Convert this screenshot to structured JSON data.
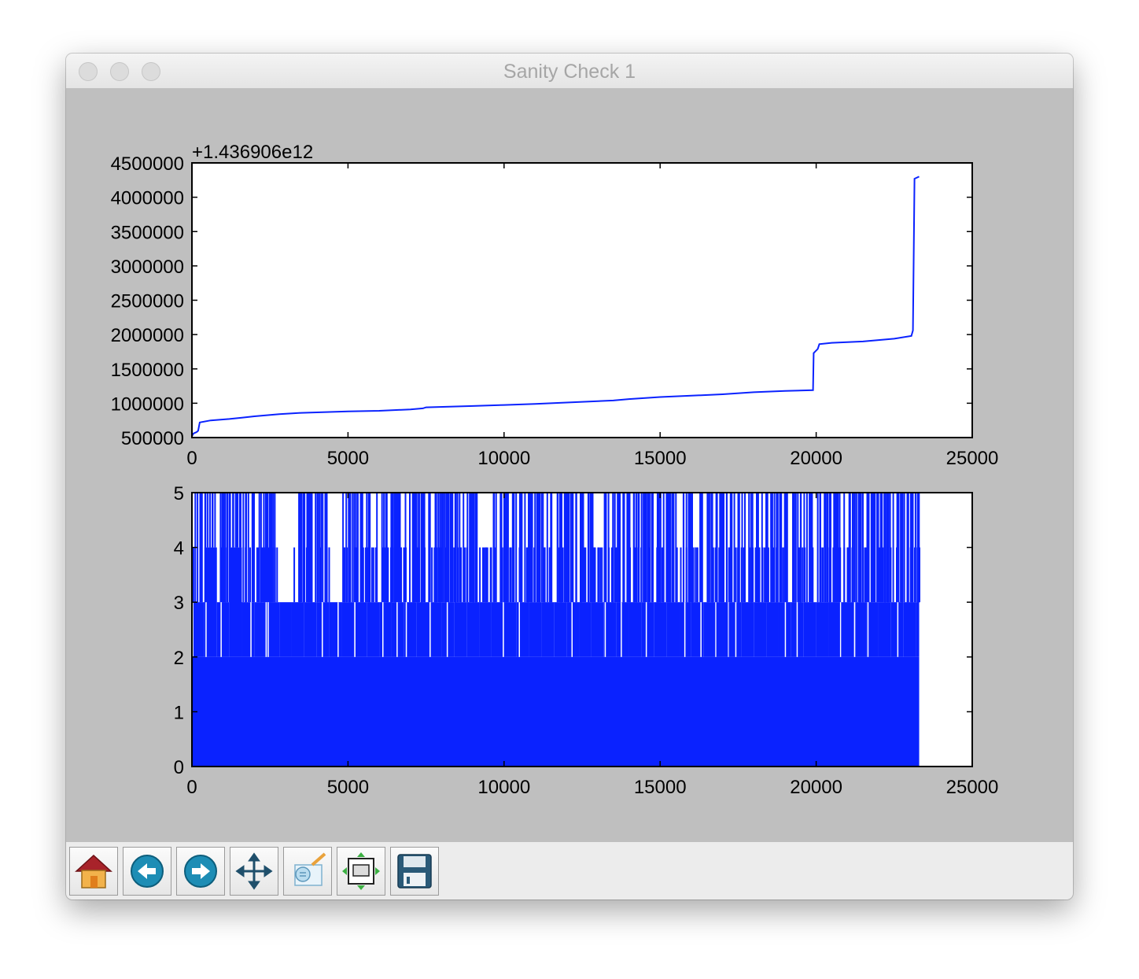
{
  "window": {
    "title": "Sanity Check 1"
  },
  "toolbar": {
    "buttons": [
      {
        "name": "home-button",
        "icon": "home-icon"
      },
      {
        "name": "back-button",
        "icon": "arrow-left-icon"
      },
      {
        "name": "forward-button",
        "icon": "arrow-right-icon"
      },
      {
        "name": "pan-button",
        "icon": "move-icon"
      },
      {
        "name": "zoom-button",
        "icon": "zoom-rect-icon"
      },
      {
        "name": "subplots-button",
        "icon": "subplots-icon"
      },
      {
        "name": "save-button",
        "icon": "floppy-disk-icon"
      }
    ]
  },
  "colors": {
    "line": "#0a22ff",
    "axes_bg": "#ffffff",
    "figure_bg": "#bfbfbf"
  },
  "chart_data": [
    {
      "type": "line",
      "offset_label": "+1.436906e12",
      "ylim": [
        500000,
        4500000
      ],
      "xlim": [
        0,
        25000
      ],
      "x_ticks": [
        "0",
        "5000",
        "10000",
        "15000",
        "20000",
        "25000"
      ],
      "y_ticks": [
        "500000",
        "1000000",
        "1500000",
        "2000000",
        "2500000",
        "3000000",
        "3500000",
        "4000000",
        "4500000"
      ],
      "grid": false,
      "series": [
        {
          "x": [
            0,
            50,
            150,
            200,
            250,
            600,
            1200,
            1600,
            2000,
            2800,
            3500,
            5000,
            6000,
            7000,
            7400,
            7500,
            9000,
            10000,
            11000,
            12000,
            13500,
            14000,
            15000,
            16000,
            17000,
            18000,
            19000,
            19900,
            19920,
            20050,
            20100,
            20500,
            21500,
            22500,
            23050,
            23100,
            23150,
            23300
          ],
          "y": [
            520000,
            560000,
            580000,
            600000,
            720000,
            750000,
            770000,
            790000,
            810000,
            840000,
            860000,
            880000,
            890000,
            910000,
            925000,
            940000,
            960000,
            975000,
            990000,
            1010000,
            1040000,
            1060000,
            1090000,
            1110000,
            1130000,
            1160000,
            1180000,
            1190000,
            1730000,
            1790000,
            1860000,
            1880000,
            1900000,
            1940000,
            1980000,
            2060000,
            4270000,
            4300000
          ]
        }
      ]
    },
    {
      "type": "bar",
      "ylim": [
        0,
        5
      ],
      "xlim": [
        0,
        25000
      ],
      "x_ticks": [
        "0",
        "5000",
        "10000",
        "15000",
        "20000",
        "25000"
      ],
      "y_ticks": [
        "0",
        "1",
        "2",
        "3",
        "4",
        "5"
      ],
      "grid": false,
      "data_extent": [
        0,
        23300
      ],
      "values_by_x": [
        {
          "x": 0,
          "top": 5,
          "base": 3
        },
        {
          "x": 400,
          "top": 5,
          "base": 4
        },
        {
          "x": 800,
          "top": 5,
          "base": 3
        },
        {
          "x": 1200,
          "top": 5,
          "base": 4
        },
        {
          "x": 1600,
          "top": 5,
          "base": 3
        },
        {
          "x": 2000,
          "top": 5,
          "base": 3
        },
        {
          "x": 2400,
          "top": 5,
          "base": 3
        },
        {
          "x": 2800,
          "top": 3,
          "base": 3
        },
        {
          "x": 3200,
          "top": 5,
          "base": 3
        },
        {
          "x": 3600,
          "top": 5,
          "base": 3
        },
        {
          "x": 4000,
          "top": 5,
          "base": 3
        },
        {
          "x": 4400,
          "top": 3,
          "base": 3
        },
        {
          "x": 4800,
          "top": 5,
          "base": 3
        },
        {
          "x": 5200,
          "top": 5,
          "base": 3
        },
        {
          "x": 5600,
          "top": 5,
          "base": 3
        },
        {
          "x": 6000,
          "top": 5,
          "base": 3
        },
        {
          "x": 6400,
          "top": 5,
          "base": 3
        },
        {
          "x": 6800,
          "top": 5,
          "base": 3
        },
        {
          "x": 7200,
          "top": 5,
          "base": 3
        },
        {
          "x": 7600,
          "top": 5,
          "base": 3
        },
        {
          "x": 8000,
          "top": 5,
          "base": 3
        },
        {
          "x": 8400,
          "top": 5,
          "base": 3
        },
        {
          "x": 8800,
          "top": 5,
          "base": 3
        },
        {
          "x": 9200,
          "top": 4,
          "base": 3
        },
        {
          "x": 9600,
          "top": 5,
          "base": 3
        },
        {
          "x": 10000,
          "top": 5,
          "base": 3
        },
        {
          "x": 10400,
          "top": 5,
          "base": 3
        },
        {
          "x": 10800,
          "top": 5,
          "base": 3
        },
        {
          "x": 11200,
          "top": 5,
          "base": 3
        },
        {
          "x": 11600,
          "top": 5,
          "base": 3
        },
        {
          "x": 12000,
          "top": 5,
          "base": 3
        },
        {
          "x": 12400,
          "top": 5,
          "base": 3
        },
        {
          "x": 12800,
          "top": 5,
          "base": 3
        },
        {
          "x": 13200,
          "top": 5,
          "base": 3
        },
        {
          "x": 13600,
          "top": 5,
          "base": 3
        },
        {
          "x": 14000,
          "top": 5,
          "base": 3
        },
        {
          "x": 14400,
          "top": 5,
          "base": 3
        },
        {
          "x": 14800,
          "top": 5,
          "base": 3
        },
        {
          "x": 15200,
          "top": 5,
          "base": 3
        },
        {
          "x": 15600,
          "top": 5,
          "base": 3
        },
        {
          "x": 16000,
          "top": 5,
          "base": 3
        },
        {
          "x": 16400,
          "top": 5,
          "base": 3
        },
        {
          "x": 16800,
          "top": 5,
          "base": 3
        },
        {
          "x": 17200,
          "top": 5,
          "base": 3
        },
        {
          "x": 17600,
          "top": 5,
          "base": 3
        },
        {
          "x": 18000,
          "top": 5,
          "base": 3
        },
        {
          "x": 18400,
          "top": 5,
          "base": 3
        },
        {
          "x": 18800,
          "top": 5,
          "base": 3
        },
        {
          "x": 19200,
          "top": 5,
          "base": 3
        },
        {
          "x": 19600,
          "top": 5,
          "base": 3
        },
        {
          "x": 20000,
          "top": 5,
          "base": 3
        },
        {
          "x": 20400,
          "top": 5,
          "base": 3
        },
        {
          "x": 20800,
          "top": 5,
          "base": 3
        },
        {
          "x": 21200,
          "top": 5,
          "base": 3
        },
        {
          "x": 21600,
          "top": 5,
          "base": 3
        },
        {
          "x": 22000,
          "top": 5,
          "base": 3
        },
        {
          "x": 22400,
          "top": 5,
          "base": 3
        },
        {
          "x": 22800,
          "top": 5,
          "base": 3
        },
        {
          "x": 23200,
          "top": 5,
          "base": 3
        }
      ]
    }
  ]
}
